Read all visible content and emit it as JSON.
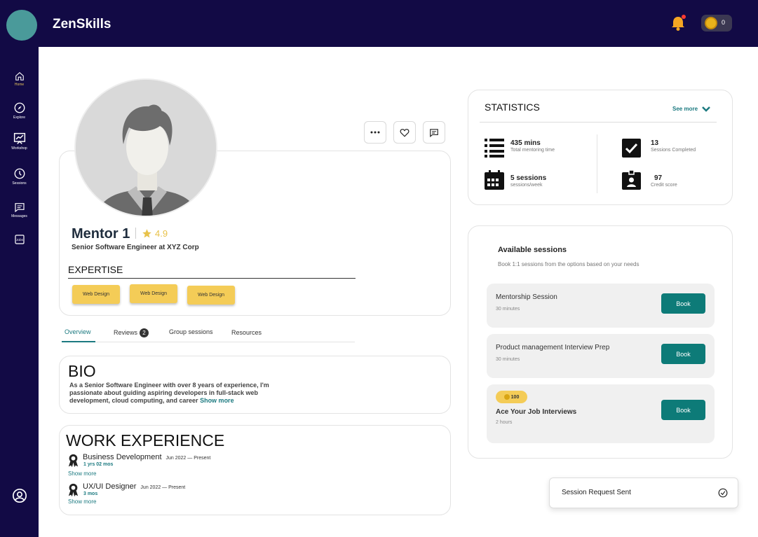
{
  "app": {
    "name": "ZenSkills",
    "coin_count": "0"
  },
  "nav": {
    "items": [
      {
        "label": "Home",
        "icon": "home-icon"
      },
      {
        "label": "Explore",
        "icon": "compass-icon"
      },
      {
        "label": "Workshop",
        "icon": "presentation-icon"
      },
      {
        "label": "Sessions",
        "icon": "clock-icon"
      },
      {
        "label": "Messages",
        "icon": "message-icon"
      },
      {
        "label": "Jobs",
        "icon": "jobs-icon"
      }
    ],
    "active": "Home"
  },
  "profile": {
    "name": "Mentor 1",
    "rating": "4.9",
    "title": "Senior Software Engineer at XYZ Corp",
    "expertise_heading": "EXPERTISE",
    "tags": [
      "Web Design",
      "Web Design",
      "Web Design"
    ]
  },
  "tabs": {
    "overview": "Overview",
    "reviews": "Reviews",
    "reviews_count": "2",
    "group_sessions": "Group sessions",
    "resources": "Resources"
  },
  "bio": {
    "heading": "BIO",
    "text": "As a Senior Software Engineer with over 8 years of experience, I'm passionate about guiding aspiring developers in full-stack web development, cloud computing, and career",
    "show_more": "Show more"
  },
  "work": {
    "heading": "WORK EXPERIENCE",
    "jobs": [
      {
        "role": "Business Development",
        "dates": "Jun 2022 — Present",
        "duration": "1 yrs 02 mos",
        "show_more": "Show more"
      },
      {
        "role": "UX/UI Designer",
        "dates": "Jun 2022 — Present",
        "duration": "3 mos",
        "show_more": "Show more"
      }
    ]
  },
  "statistics": {
    "heading": "STATISTICS",
    "see_more": "See more",
    "items": [
      {
        "value": "435 mins",
        "label": "Total mentoring time",
        "icon": "list-icon"
      },
      {
        "value": "13",
        "label": "Sessions Completed",
        "icon": "checkbox-icon"
      },
      {
        "value": "5 sessions",
        "label": "sessions/week",
        "icon": "calendar-icon"
      },
      {
        "value": "97",
        "label": "Credit score",
        "icon": "id-badge-icon"
      }
    ]
  },
  "available": {
    "heading": "Available sessions",
    "subheading": "Book 1:1 sessions from the options based on your needs",
    "sessions": [
      {
        "title": "Mentorship Session",
        "duration": "30 minutes",
        "book": "Book"
      },
      {
        "title": "Product management Interview Prep",
        "duration": "30 minutes",
        "book": "Book"
      },
      {
        "title": "Ace Your Job Interviews",
        "duration": "2 hours",
        "book": "Book",
        "credits": "100"
      }
    ]
  },
  "toast": {
    "text": "Session Request Sent"
  },
  "colors": {
    "nav_bg": "#120a45",
    "accent": "#0d7b78",
    "tag": "#f4cc57"
  }
}
